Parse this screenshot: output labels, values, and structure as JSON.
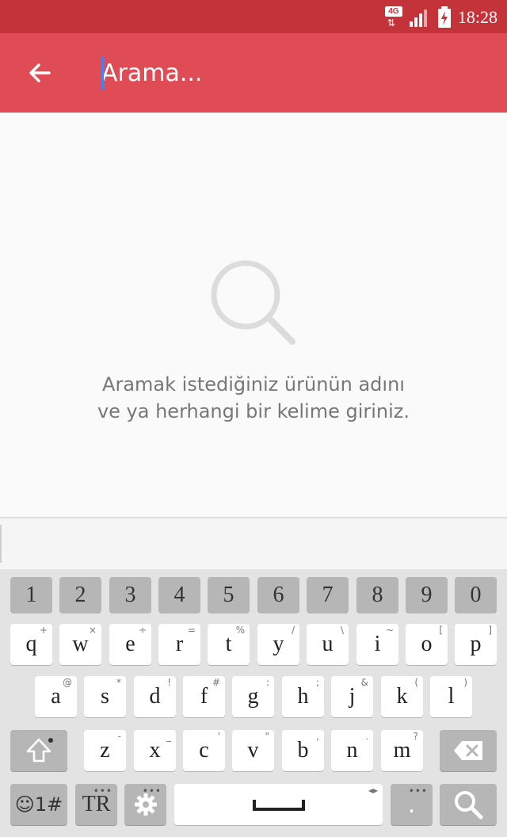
{
  "status_bar": {
    "network": "4G",
    "time": "18:28"
  },
  "search": {
    "placeholder": "Arama..."
  },
  "empty_state": {
    "line1": "Aramak istediğiniz ürünün adını",
    "line2": "ve ya herhangi bir kelime giriniz."
  },
  "keyboard": {
    "number_row": [
      "1",
      "2",
      "3",
      "4",
      "5",
      "6",
      "7",
      "8",
      "9",
      "0"
    ],
    "row1": [
      {
        "key": "q",
        "hint": "+"
      },
      {
        "key": "w",
        "hint": "×"
      },
      {
        "key": "e",
        "hint": "÷"
      },
      {
        "key": "r",
        "hint": "="
      },
      {
        "key": "t",
        "hint": "%"
      },
      {
        "key": "y",
        "hint": "/"
      },
      {
        "key": "u",
        "hint": "\\"
      },
      {
        "key": "i",
        "hint": "~"
      },
      {
        "key": "o",
        "hint": "["
      },
      {
        "key": "p",
        "hint": "]"
      }
    ],
    "row2": [
      {
        "key": "a",
        "hint": "@"
      },
      {
        "key": "s",
        "hint": "*"
      },
      {
        "key": "d",
        "hint": "!"
      },
      {
        "key": "f",
        "hint": "#"
      },
      {
        "key": "g",
        "hint": ":"
      },
      {
        "key": "h",
        "hint": ";"
      },
      {
        "key": "j",
        "hint": "&"
      },
      {
        "key": "k",
        "hint": "("
      },
      {
        "key": "l",
        "hint": ")"
      }
    ],
    "row3": [
      {
        "key": "z",
        "hint": "-"
      },
      {
        "key": "x",
        "hint": "_"
      },
      {
        "key": "c",
        "hint": "'"
      },
      {
        "key": "v",
        "hint": "\""
      },
      {
        "key": "b",
        "hint": ","
      },
      {
        "key": "n",
        "hint": "."
      },
      {
        "key": "m",
        "hint": "?"
      }
    ],
    "symbols_label": "☺1#",
    "language_label": "TR",
    "period_label": ".",
    "space_arrows": "◂▸"
  }
}
